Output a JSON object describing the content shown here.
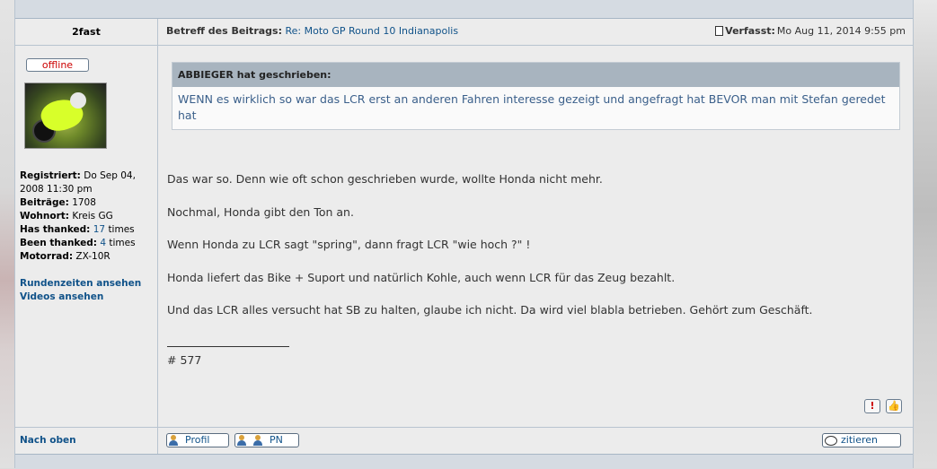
{
  "post": {
    "author": "2fast",
    "subject_label": "Betreff des Beitrags:",
    "subject_link": "Re: Moto GP Round 10 Indianapolis",
    "posted_label": "Verfasst:",
    "posted_date": "Mo Aug 11, 2014 9:55 pm",
    "status": "offline"
  },
  "profile": {
    "registered_label": "Registriert:",
    "registered_value": "Do Sep 04, 2008 11:30 pm",
    "posts_label": "Beiträge:",
    "posts_value": "1708",
    "residence_label": "Wohnort:",
    "residence_value": "Kreis GG",
    "has_thanked_label": "Has thanked:",
    "has_thanked_count": "17",
    "has_thanked_unit": "times",
    "been_thanked_label": "Been thanked:",
    "been_thanked_count": "4",
    "been_thanked_unit": "times",
    "bike_label": "Motorrad:",
    "bike_value": "ZX-10R",
    "links": [
      "Rundenzeiten ansehen",
      "Videos ansehen"
    ],
    "back_to_top": "Nach oben"
  },
  "quote": {
    "header": "ABBIEGER hat geschrieben:",
    "text": "WENN es wirklich so war das LCR erst an anderen Fahren interesse gezeigt und angefragt hat BEVOR man mit Stefan geredet hat"
  },
  "body": {
    "paragraphs": [
      "Das war so. Denn wie oft schon geschrieben wurde, wollte Honda nicht mehr.",
      "Nochmal, Honda gibt den Ton an.",
      "Wenn Honda zu LCR sagt \"spring\", dann fragt LCR \"wie hoch ?\" !",
      "Honda liefert das Bike + Suport und natürlich Kohle, auch wenn LCR für das Zeug bezahlt.",
      "Und das LCR alles versucht hat SB zu halten, glaube ich nicht. Da wird viel blabla betrieben. Gehört zum Geschäft."
    ],
    "signature": "# 577"
  },
  "actions": {
    "report_icon": "!",
    "thanks_icon": "👍",
    "profil_label": "Profil",
    "pn_label": "PN",
    "quote_label": "zitieren"
  }
}
